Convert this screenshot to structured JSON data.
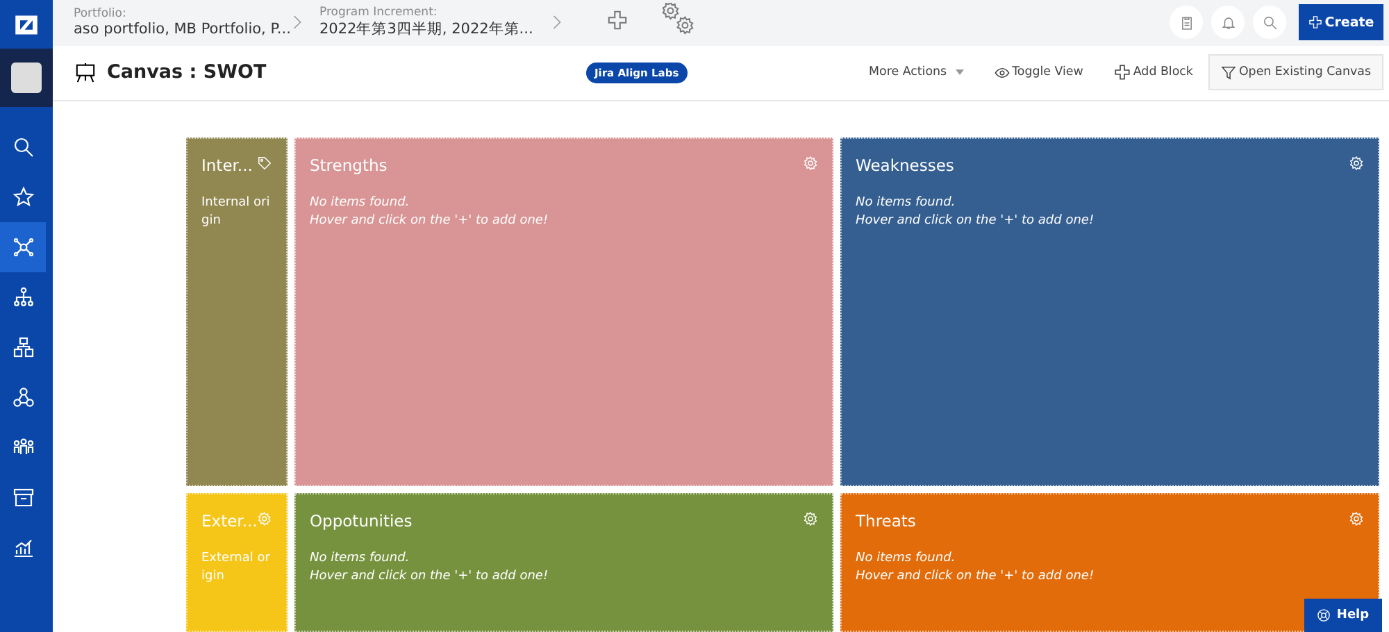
{
  "topbar": {
    "portfolio_label": "Portfolio:",
    "portfolio_value": "aso portfolio, MB Portfolio, P...",
    "pi_label": "Program Increment:",
    "pi_value": "2022年第3四半期, 2022年第...",
    "create_button": "Create"
  },
  "sidebar": {
    "items": [
      {
        "kind": "search",
        "selected": false
      },
      {
        "kind": "star",
        "selected": false
      },
      {
        "kind": "network",
        "selected": true
      },
      {
        "kind": "hierarchy",
        "selected": false
      },
      {
        "kind": "blocks",
        "selected": false
      },
      {
        "kind": "cluster",
        "selected": false
      },
      {
        "kind": "people",
        "selected": false
      },
      {
        "kind": "archive",
        "selected": false
      },
      {
        "kind": "chart",
        "selected": false
      }
    ]
  },
  "header": {
    "title": "Canvas : SWOT",
    "badge": "Jira Align Labs",
    "actions": [
      {
        "kind": "menu",
        "label": "More Actions"
      },
      {
        "kind": "eye",
        "label": "Toggle View"
      },
      {
        "kind": "plus",
        "label": "Add Block"
      },
      {
        "kind": "filter",
        "label": "Open Existing Canvas"
      }
    ]
  },
  "blocks": [
    {
      "kind": "side",
      "title": "Inter...",
      "color": "#918750",
      "text": "Internal origin"
    },
    {
      "kind": "main",
      "title": "Strengths",
      "color": "#d99595",
      "empty": "No items found.",
      "hint": "Hover and click on the '+' to add one!"
    },
    {
      "kind": "main",
      "title": "Weaknesses",
      "color": "#355f91",
      "empty": "No items found.",
      "hint": "Hover and click on the '+' to add one!"
    },
    {
      "kind": "side",
      "title": "Exter...",
      "color": "#f5c518",
      "text": "External origin"
    },
    {
      "kind": "main",
      "title": "Oppotunities",
      "color": "#77923e",
      "empty": "No items found.",
      "hint": "Hover and click on the '+' to add one!"
    },
    {
      "kind": "main",
      "title": "Threats",
      "color": "#e26b0a",
      "empty": "No items found.",
      "hint": "Hover and click on the '+' to add one!"
    }
  ],
  "help_button": "Help"
}
